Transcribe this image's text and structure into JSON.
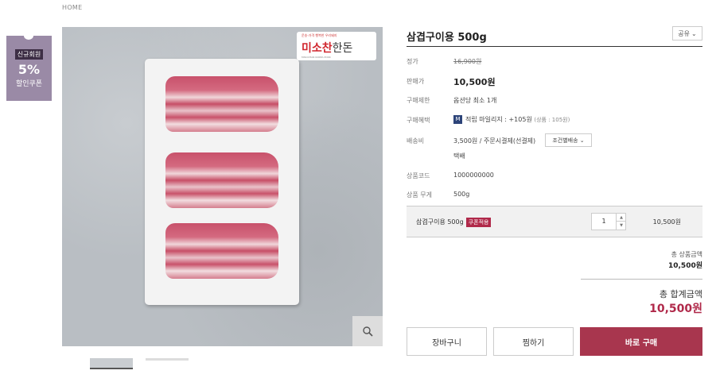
{
  "breadcrumb": "HOME",
  "coupon": {
    "tag": "신규회원",
    "percent": "5%",
    "text": "할인쿠폰"
  },
  "product": {
    "title": "삼겹구이용 500g",
    "share_label": "공유",
    "logo_small": "운송-가격 행복한 우리돼지",
    "logo_main": "미소찬",
    "logo_suffix": "한돈",
    "logo_sub": "MISOCHAN KOREA PORK"
  },
  "info": [
    {
      "label": "정가",
      "value": "16,900원"
    },
    {
      "label": "판매가",
      "value": "10,500원"
    },
    {
      "label": "구매제한",
      "value": "옵션당 최소 1개"
    },
    {
      "label": "구매혜택",
      "value": "적립 마일리지 : +105원",
      "note": "(상품 : 105원)",
      "badge": "M"
    },
    {
      "label": "배송비",
      "value": "3,500원  / 주문시결제(선결제)",
      "option_label": "조건별배송",
      "extra": "택배"
    },
    {
      "label": "상품코드",
      "value": "1000000000"
    },
    {
      "label": "상품 무게",
      "value": "500g"
    }
  ],
  "option": {
    "name": "삼겹구이용 500g",
    "badge": "쿠폰적용",
    "qty": "1",
    "price": "10,500원"
  },
  "summary": {
    "subtotal_label": "총 상품금액",
    "subtotal": "10,500원",
    "total_label": "총 합계금액",
    "total": "10,500원"
  },
  "buttons": {
    "cart": "장바구니",
    "wish": "찜하기",
    "buy": "바로 구매"
  },
  "colors": {
    "accent": "#a8364e",
    "coupon": "#9a8aa6"
  }
}
